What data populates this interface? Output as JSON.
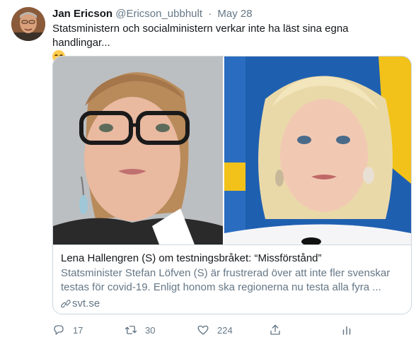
{
  "tweet": {
    "author_name": "Jan Ericson",
    "handle": "@Ericson_ubbhult",
    "separator": "·",
    "date": "May 28",
    "text": "Statsministern och socialministern verkar inte ha läst sina egna handlingar...",
    "emoji": "relieved-face"
  },
  "card": {
    "title": "Lena Hallengren (S) om testningsbråket: “Missförstånd”",
    "description": "Statsminister Stefan Löfven (S) är frustrerad över att inte fler svenskar testas för covid-19. Enligt honom ska regionerna nu testa alla fyra ...",
    "domain": "svt.se"
  },
  "actions": {
    "reply_count": "17",
    "retweet_count": "30",
    "like_count": "224"
  },
  "colors": {
    "text": "#14171a",
    "secondary": "#657786",
    "border": "#ccd6dd",
    "flag_blue": "#1f5fb0",
    "flag_yellow": "#f2c21a"
  }
}
